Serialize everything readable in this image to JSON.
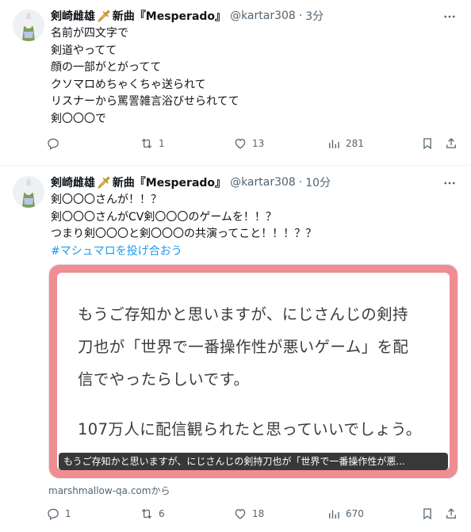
{
  "tweets": [
    {
      "author": {
        "name": "剣崎雌雄",
        "name_suffix": "新曲『Mesperado』",
        "handle": "@kartar308",
        "time": "3分"
      },
      "lines": [
        "名前が四文字で",
        "剣道やってて",
        "顔の一部がとがってて",
        "クソマロめちゃくちゃ送られて",
        "リスナーから罵詈雑言浴びせられてて",
        "剣〇〇〇で"
      ],
      "actions": {
        "replies": "",
        "retweets": "1",
        "likes": "13",
        "views": "281"
      }
    },
    {
      "author": {
        "name": "剣崎雌雄",
        "name_suffix": "新曲『Mesperado』",
        "handle": "@kartar308",
        "time": "10分"
      },
      "lines": [
        "剣〇〇〇さんが！！？",
        "剣〇〇〇さんがCV剣〇〇〇のゲームを！！？",
        "つまり剣〇〇〇と剣〇〇〇の共演ってこと！！！？？"
      ],
      "hashtag": "#マシュマロを投げ合おう",
      "card": {
        "lines": [
          "もうご存知かと思いますが、にじさんじの剣持",
          "刀也が「世界で一番操作性が悪いゲーム」を配",
          "信でやったらしいです。",
          "107万人に配信観られたと思っていいでしょう。"
        ],
        "caption": "もうご存知かと思いますが、にじさんじの剣持刀也が「世界で一番操作性が悪...",
        "border_color": "#ef8d93"
      },
      "source": "marshmallow-qa.comから",
      "actions": {
        "replies": "1",
        "retweets": "6",
        "likes": "18",
        "views": "670"
      }
    }
  ],
  "colors": {
    "text": "#0f1419",
    "secondary": "#536471",
    "link": "#1d9bf0"
  },
  "icons": [
    "more-icon",
    "reply-icon",
    "retweet-icon",
    "like-icon",
    "views-icon",
    "bookmark-icon",
    "share-icon"
  ]
}
